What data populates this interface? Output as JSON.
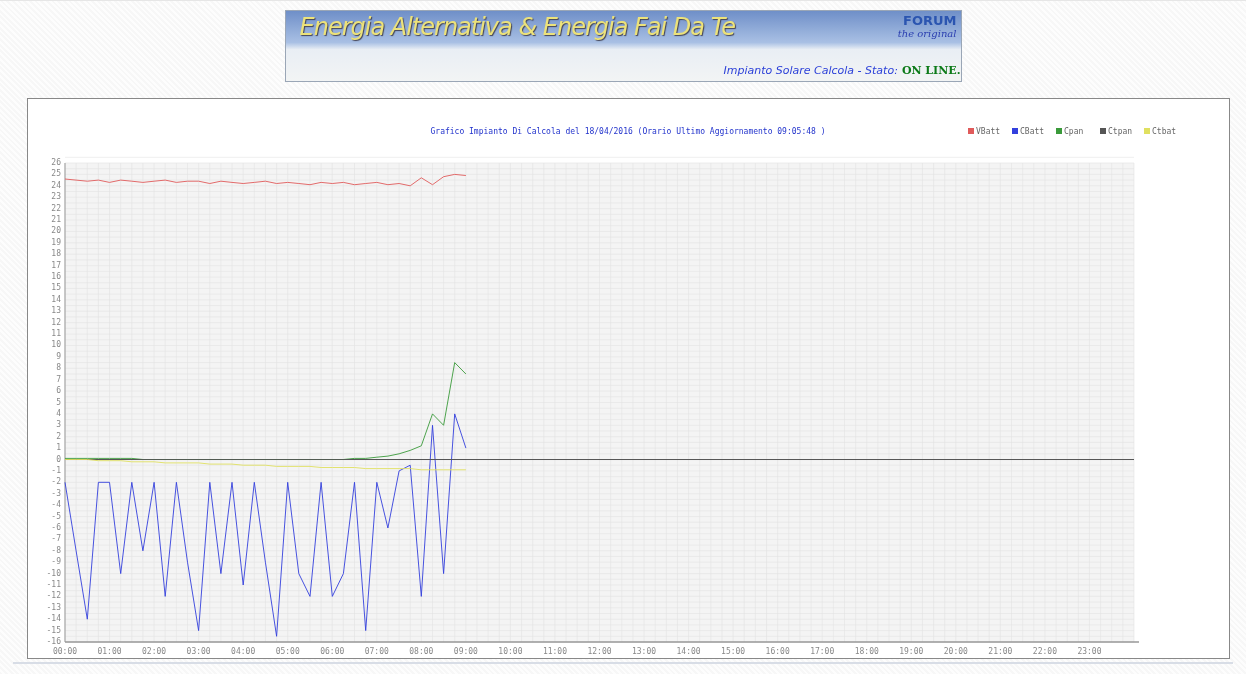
{
  "banner": {
    "title": "Energia Alternativa & Energia Fai Da Te",
    "badge_top": "FORUM",
    "badge_bottom": "the original",
    "status_label": "Impianto Solare Calcola - Stato:",
    "status_value": "ON LINE."
  },
  "chart": {
    "chart_data": {
      "type": "line",
      "title": "Grafico Impianto Di Calcola del 18/04/2016 (Orario Ultimo Aggiornamento 09:05:48 )",
      "x": [
        0,
        0.25,
        0.5,
        0.75,
        1,
        1.25,
        1.5,
        1.75,
        2,
        2.25,
        2.5,
        2.75,
        3,
        3.25,
        3.5,
        3.75,
        4,
        4.25,
        4.5,
        4.75,
        5,
        5.25,
        5.5,
        5.75,
        6,
        6.25,
        6.5,
        6.75,
        7,
        7.25,
        7.5,
        7.75,
        8,
        8.25,
        8.5,
        8.75,
        9
      ],
      "series": [
        {
          "name": "VBatt",
          "color": "#e05a5a",
          "values": [
            24.6,
            24.5,
            24.4,
            24.5,
            24.3,
            24.5,
            24.4,
            24.3,
            24.4,
            24.5,
            24.3,
            24.4,
            24.4,
            24.2,
            24.4,
            24.3,
            24.2,
            24.3,
            24.4,
            24.2,
            24.3,
            24.2,
            24.1,
            24.3,
            24.2,
            24.3,
            24.1,
            24.2,
            24.3,
            24.1,
            24.2,
            24.0,
            24.7,
            24.1,
            24.8,
            25.0,
            24.9
          ]
        },
        {
          "name": "CBatt",
          "color": "#3340dd",
          "values": [
            -2,
            -8,
            -14,
            -2,
            -2,
            -10,
            -2,
            -8,
            -2,
            -12,
            -2,
            -9,
            -15,
            -2,
            -10,
            -2,
            -11,
            -2,
            -9,
            -15.5,
            -2,
            -10,
            -12,
            -2,
            -12,
            -10,
            -2,
            -15,
            -2,
            -6,
            -1,
            -0.5,
            -12,
            3,
            -10,
            4,
            1
          ]
        },
        {
          "name": "Cpan",
          "color": "#3a9a3a",
          "values": [
            0.1,
            0.1,
            0.1,
            0.1,
            0.1,
            0.1,
            0.1,
            0,
            0,
            0,
            0,
            0,
            0,
            0,
            0,
            0,
            0,
            0,
            0,
            0,
            0,
            0,
            0,
            0,
            0,
            0,
            0.1,
            0.1,
            0.2,
            0.3,
            0.5,
            0.8,
            1.2,
            4,
            3,
            8.5,
            7.5
          ]
        },
        {
          "name": "Ctpan",
          "color": "#555555",
          "values": [
            0,
            0,
            0,
            0,
            0,
            0,
            0,
            0,
            0,
            0,
            0,
            0,
            0,
            0,
            0,
            0,
            0,
            0,
            0,
            0,
            0,
            0,
            0,
            0,
            0,
            0,
            0,
            0,
            0,
            0,
            0,
            0,
            0,
            0,
            0,
            0,
            0
          ]
        },
        {
          "name": "Ctbat",
          "color": "#e0e060",
          "values": [
            0,
            0,
            0,
            -0.1,
            -0.1,
            -0.1,
            -0.2,
            -0.2,
            -0.2,
            -0.3,
            -0.3,
            -0.3,
            -0.3,
            -0.4,
            -0.4,
            -0.4,
            -0.5,
            -0.5,
            -0.5,
            -0.6,
            -0.6,
            -0.6,
            -0.6,
            -0.7,
            -0.7,
            -0.7,
            -0.7,
            -0.8,
            -0.8,
            -0.8,
            -0.8,
            -0.8,
            -0.9,
            -0.9,
            -0.9,
            -0.9,
            -0.9
          ]
        }
      ],
      "xlim": [
        0,
        24
      ],
      "ylim": [
        -16,
        26
      ],
      "grid": true,
      "legend": true,
      "xticks": [
        {
          "value": 0,
          "label": "00:00"
        },
        {
          "value": 1,
          "label": "01:00"
        },
        {
          "value": 2,
          "label": "02:00"
        },
        {
          "value": 3,
          "label": "03:00"
        },
        {
          "value": 4,
          "label": "04:00"
        },
        {
          "value": 5,
          "label": "05:00"
        },
        {
          "value": 6,
          "label": "06:00"
        },
        {
          "value": 7,
          "label": "07:00"
        },
        {
          "value": 8,
          "label": "08:00"
        },
        {
          "value": 9,
          "label": "09:00"
        },
        {
          "value": 10,
          "label": "10:00"
        },
        {
          "value": 11,
          "label": "11:00"
        },
        {
          "value": 12,
          "label": "12:00"
        },
        {
          "value": 13,
          "label": "13:00"
        },
        {
          "value": 14,
          "label": "14:00"
        },
        {
          "value": 15,
          "label": "15:00"
        },
        {
          "value": 16,
          "label": "16:00"
        },
        {
          "value": 17,
          "label": "17:00"
        },
        {
          "value": 18,
          "label": "18:00"
        },
        {
          "value": 19,
          "label": "19:00"
        },
        {
          "value": 20,
          "label": "20:00"
        },
        {
          "value": 21,
          "label": "21:00"
        },
        {
          "value": 22,
          "label": "22:00"
        },
        {
          "value": 23,
          "label": "23:00"
        }
      ],
      "yticks": [
        -16,
        -15,
        -14,
        -13,
        -12,
        -11,
        -10,
        -9,
        -8,
        -7,
        -6,
        -5,
        -4,
        -3,
        -2,
        -1,
        0,
        1,
        2,
        3,
        4,
        5,
        6,
        7,
        8,
        9,
        10,
        11,
        12,
        13,
        14,
        15,
        16,
        17,
        18,
        19,
        20,
        21,
        22,
        23,
        24,
        25,
        26
      ]
    }
  }
}
